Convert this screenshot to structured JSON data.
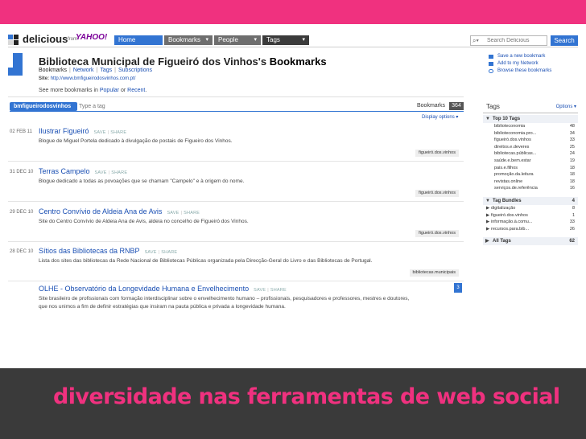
{
  "caption": "diversidade nas ferramentas de web social",
  "nav": {
    "logo": "delicious",
    "from": "from",
    "yahoo": "YAHOO!",
    "tabs": [
      {
        "label": "Home",
        "caret": ""
      },
      {
        "label": "Bookmarks",
        "caret": "▾"
      },
      {
        "label": "People",
        "caret": "▾"
      },
      {
        "label": "Tags",
        "caret": "▾"
      }
    ],
    "search_placeholder": "Search Delicious",
    "search_button": "Search"
  },
  "profile": {
    "title_prefix": "Biblioteca Municipal de Figueiró dos Vinhos's ",
    "title_suffix": "Bookmarks",
    "subnav": [
      "Bookmarks",
      "Network",
      "Tags",
      "Subscriptions"
    ],
    "site_label": "Site:",
    "site_url": "http://www.bmfigueirodosvinhos.com.pt/",
    "more_prefix": "See more bookmarks in ",
    "more_popular": "Popular",
    "more_or": " or ",
    "more_recent": "Recent",
    "more_suffix": "."
  },
  "actions": [
    "Save a new bookmark",
    "Add to my Network",
    "Browse these bookmarks"
  ],
  "filter": {
    "user": "bmfigueirodosvinhos",
    "tag_placeholder": "Type a tag",
    "bookmarks_label": "Bookmarks",
    "bookmarks_count": "364",
    "display_options": "Display options ▾"
  },
  "bookmark_actions": {
    "save": "SAVE",
    "share": "SHARE"
  },
  "bookmarks": [
    {
      "date": "02 FEB 11",
      "title": "Ilustrar Figueiró",
      "desc": "Blogue de Miguel Portela dedicado à divulgação de postais de Figueiro dos Vinhos.",
      "tag": "figueiró.dos.vinhos"
    },
    {
      "date": "31 DEC 10",
      "title": "Terras Campelo",
      "desc": "Blogue dedicado a todas as povoações que se chamam \"Campelo\" e à origem do nome.",
      "tag": "figueiró.dos.vinhos"
    },
    {
      "date": "29 DEC 10",
      "title": "Centro Convívio de Aldeia Ana de Avis",
      "desc": "Site do Centro Convívio de Aldeia Ana de Avis, aldeia no concelho de Figueiró dos Vinhos.",
      "tag": "figueiró.dos.vinhos"
    },
    {
      "date": "28 DEC 10",
      "title": "Sítios das Bibliotecas da RNBP",
      "desc": "Lista dos sites das bibliotecas da Rede Nacional de Bibliotecas Públicas organizada pela Direcção-Geral do Livro e das Bibliotecas de Portugal.",
      "tag": "bibliotecas.municipais"
    },
    {
      "date": "",
      "title": "OLHE - Observatório da Longevidade Humana e Envelhecimento",
      "desc": "Site brasileiro de profissionais com formação interdisciplinar sobre o envelhecimento humano – profissionais, pesquisadores e professores, mestres e doutores,",
      "desc2": "que nos unimos a fim de definir estratégias que insiram na pauta pública e privada a longevidade humana.",
      "tag": "",
      "count": "3"
    }
  ],
  "sidebar": {
    "title": "Tags",
    "options": "Options ▾",
    "top_tags_title": "Top 10 Tags",
    "top_tags": [
      {
        "name": "biblioteconomia",
        "count": "48"
      },
      {
        "name": "biblioteconomia.pro...",
        "count": "34"
      },
      {
        "name": "figueiró.dos.vinhos",
        "count": "33"
      },
      {
        "name": "direitos.e.deveres",
        "count": "25"
      },
      {
        "name": "bibliotecas.públicas...",
        "count": "24"
      },
      {
        "name": "saúde.e.bem.estar",
        "count": "19"
      },
      {
        "name": "pais.e.filhos",
        "count": "18"
      },
      {
        "name": "promoção.da.leitura",
        "count": "18"
      },
      {
        "name": "revistas.online",
        "count": "18"
      },
      {
        "name": "serviços.de.referência",
        "count": "16"
      }
    ],
    "bundles_title": "Tag Bundles",
    "bundles_count": "4",
    "bundles": [
      {
        "name": "digitalização",
        "count": "8"
      },
      {
        "name": "figueiró.dos.vinhos",
        "count": "1"
      },
      {
        "name": "informação.à.comu...",
        "count": "33"
      },
      {
        "name": "recursos.para.bib...",
        "count": "26"
      }
    ],
    "all_tags_title": "All Tags",
    "all_tags_count": "62"
  },
  "colors": {
    "accent": "#f0317f",
    "link": "#1a4fb3",
    "delicious_blue": "#3274d2"
  }
}
